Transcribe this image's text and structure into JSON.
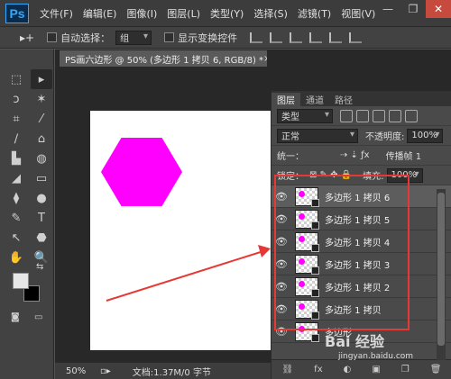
{
  "app": {
    "logo": "Ps"
  },
  "menu": [
    "文件(F)",
    "编辑(E)",
    "图像(I)",
    "图层(L)",
    "类型(Y)",
    "选择(S)",
    "滤镜(T)",
    "视图(V)"
  ],
  "window_controls": {
    "minimize": "—",
    "maximize": "❐",
    "close": "✕"
  },
  "options_bar": {
    "tool_icon": "▸+",
    "auto_select_label": "自动选择：",
    "auto_select_value": "组",
    "show_transform_label": "显示变换控件"
  },
  "toolbox": {
    "tools": [
      "⬚",
      "▸",
      "ↄ",
      "✶",
      "⌗",
      "⁄",
      "∕",
      "⌂",
      "▙",
      "◍",
      "◢",
      "▭",
      "⧫",
      "●",
      "✎",
      "T",
      "↖",
      "⬣",
      "✋",
      "🔍"
    ],
    "colors": {
      "foreground": "#e6e6e6",
      "background": "#000000"
    }
  },
  "document": {
    "tab_title": "PS画六边形 @ 50% (多边形 1 拷贝 6, RGB/8) *",
    "close_label": "×",
    "shape_color": "#ff00ff"
  },
  "status": {
    "zoom": "50%",
    "doc_info": "文档:1.37M/0 字节"
  },
  "layers_panel": {
    "tabs": [
      "图层",
      "通道",
      "路径"
    ],
    "filter_kind": "类型",
    "blend_mode": "正常",
    "opacity_label": "不透明度:",
    "opacity_value": "100%",
    "unify_label": "统一：",
    "propagate_label": "传播帧 1",
    "lock_label": "锁定：",
    "fill_label": "填充:",
    "fill_value": "100%",
    "layers": [
      {
        "name": "多边形 1 拷贝 6",
        "visible": true,
        "selected": true
      },
      {
        "name": "多边形 1 拷贝 5",
        "visible": true,
        "selected": false
      },
      {
        "name": "多边形 1 拷贝 4",
        "visible": true,
        "selected": false
      },
      {
        "name": "多边形 1 拷贝 3",
        "visible": true,
        "selected": false
      },
      {
        "name": "多边形 1 拷贝 2",
        "visible": true,
        "selected": false
      },
      {
        "name": "多边形 1 拷贝",
        "visible": true,
        "selected": false
      },
      {
        "name": "多边形",
        "visible": true,
        "selected": false
      }
    ],
    "bottom_icons": [
      "⛓",
      "fx",
      "◐",
      "▣",
      "❐",
      "🗑"
    ]
  },
  "annotations": {
    "highlight_color": "#e53935",
    "arrow_color": "#e53935"
  },
  "watermark": {
    "text": "Bai 经验",
    "sub": "jingyan.baidu.com"
  }
}
